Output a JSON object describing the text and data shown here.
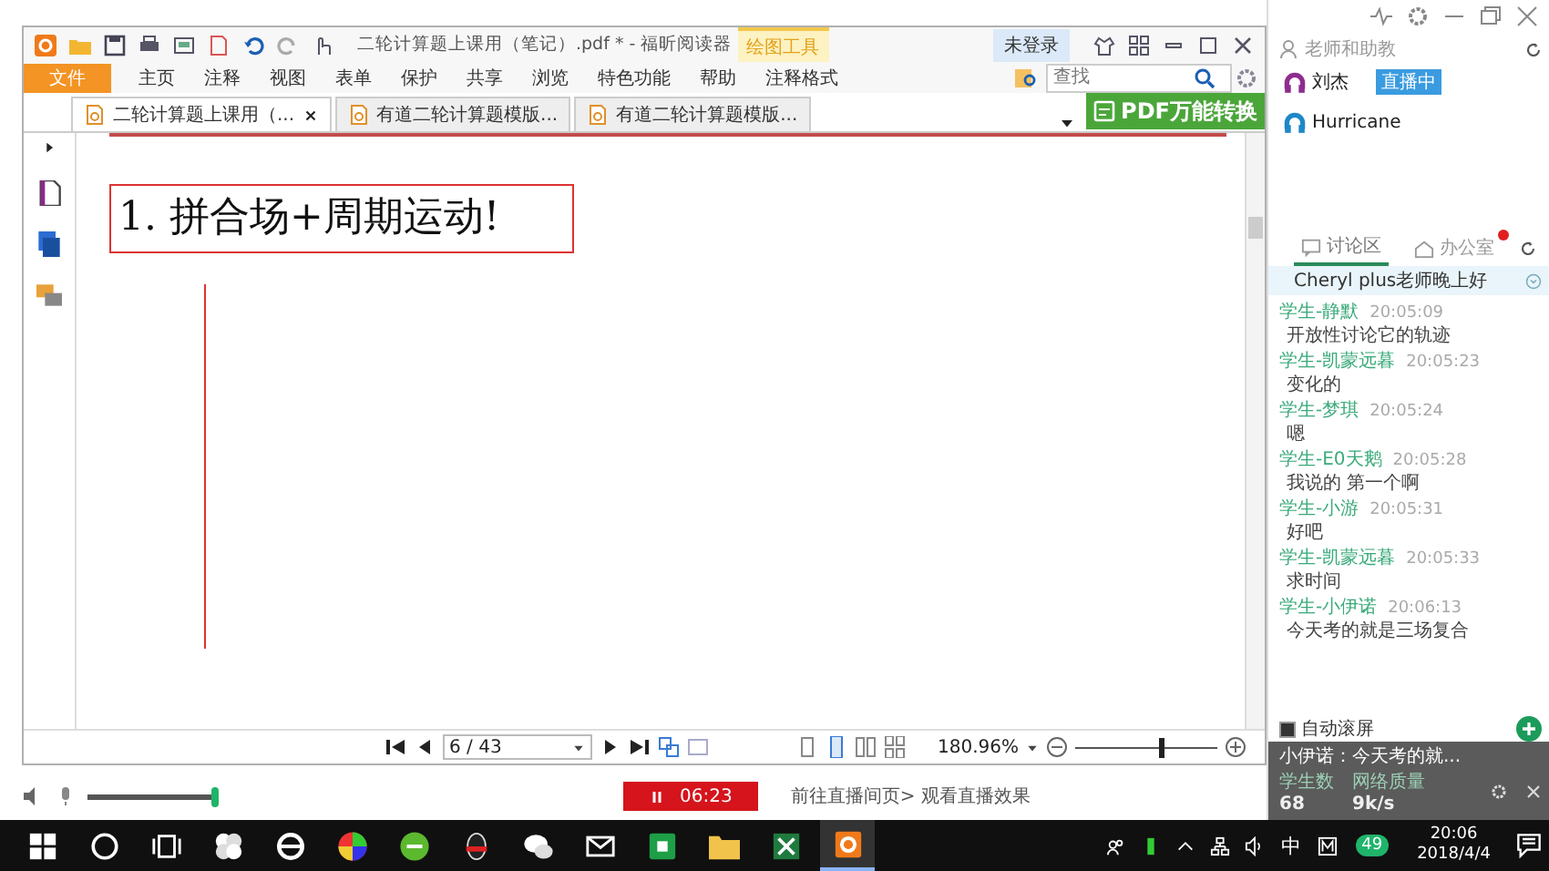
{
  "reader": {
    "title": "二轮计算题上课用（笔记）.pdf * - 福昕阅读器",
    "context_tab": "绘图工具",
    "login": "未登录",
    "menu": [
      {
        "label": "文件",
        "selected": true
      },
      {
        "label": "主页",
        "selected": false
      },
      {
        "label": "注释",
        "selected": false
      },
      {
        "label": "视图",
        "selected": false
      },
      {
        "label": "表单",
        "selected": false
      },
      {
        "label": "保护",
        "selected": false
      },
      {
        "label": "共享",
        "selected": false
      },
      {
        "label": "浏览",
        "selected": false
      },
      {
        "label": "特色功能",
        "selected": false
      },
      {
        "label": "帮助",
        "selected": false
      },
      {
        "label": "注释格式",
        "selected": false
      }
    ],
    "search": {
      "placeholder": "查找"
    },
    "doc_tabs": [
      {
        "label": "二轮计算题上课用（...",
        "selected": true
      },
      {
        "label": "有道二轮计算题模版...",
        "selected": false
      },
      {
        "label": "有道二轮计算题模版...",
        "selected": false
      }
    ],
    "convert_button": "PDF万能转换",
    "page_heading": "1. 拼合场+周期运动!",
    "page_field": "6 / 43",
    "zoom": "180.96%",
    "zoom_slider": {
      "level": 0.6
    }
  },
  "recorder": {
    "mic": {
      "level": 1
    },
    "timer": "06:23",
    "link": "前往直播间页>  观看直播效果"
  },
  "side": {
    "teachers_title": "老师和助教",
    "teachers": [
      {
        "name": "刘杰",
        "badge": "直播中",
        "color": "#8e2c8f"
      },
      {
        "name": "Hurricane",
        "color": "#1e88c8"
      }
    ],
    "chat_tabs": [
      {
        "label": "讨论区",
        "selected": true,
        "unread": false
      },
      {
        "label": "办公室",
        "selected": false,
        "unread": true
      }
    ],
    "pinned": "Cheryl plus老师晚上好",
    "messages": [
      {
        "sender": "学生-静默",
        "time": "20:05:09",
        "text": "开放性讨论它的轨迹"
      },
      {
        "sender": "学生-凯蒙远暮",
        "time": "20:05:23",
        "text": "变化的"
      },
      {
        "sender": "学生-梦琪",
        "time": "20:05:24",
        "text": "嗯"
      },
      {
        "sender": "学生-E0天鹅",
        "time": "20:05:28",
        "text": "我说的 第一个啊"
      },
      {
        "sender": "学生-小游",
        "time": "20:05:31",
        "text": "好吧"
      },
      {
        "sender": "学生-凯蒙远暮",
        "time": "20:05:33",
        "text": "求时间"
      },
      {
        "sender": "学生-小伊诺",
        "time": "20:06:13",
        "text": "今天考的就是三场复合"
      }
    ],
    "auto_scroll": {
      "label": "自动滚屏",
      "checked": true
    },
    "popup": "小伊诺：今天考的就...",
    "stats": [
      {
        "label": "学生数",
        "value": "68"
      },
      {
        "label": "网络质量",
        "value": "9k/s"
      }
    ]
  },
  "taskbar": {
    "ime": "中",
    "badge": "49",
    "time": "20:06",
    "date": "2018/4/4"
  }
}
